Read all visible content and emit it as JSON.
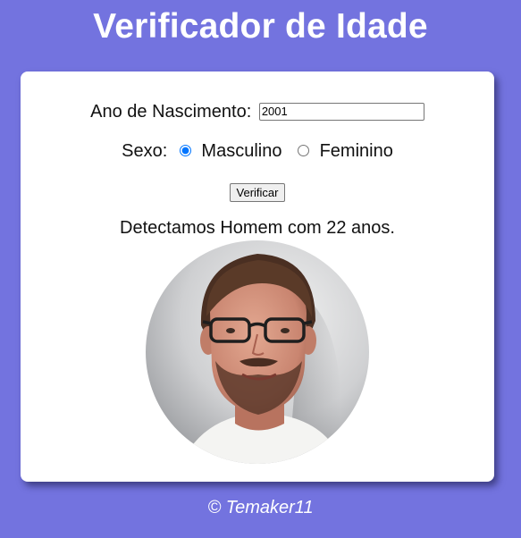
{
  "header": {
    "title": "Verificador de Idade"
  },
  "form": {
    "year_label": "Ano de Nascimento:",
    "year_value": "2001",
    "sex_label": "Sexo:",
    "options": [
      {
        "label": "Masculino",
        "checked": true
      },
      {
        "label": "Feminino",
        "checked": false
      }
    ],
    "button_label": "Verificar"
  },
  "result": {
    "text": "Detectamos Homem com 22 anos."
  },
  "footer": {
    "text": "© Temaker11"
  },
  "colors": {
    "background": "#7373df",
    "card": "#ffffff",
    "radio_accent": "#1a73e8"
  }
}
